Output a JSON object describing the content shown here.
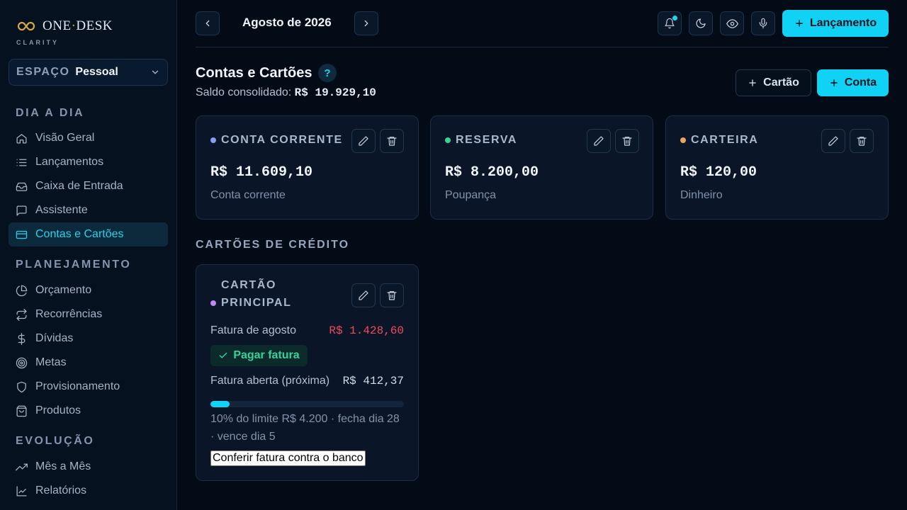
{
  "brand": {
    "name_left": "ONE",
    "name_sep": "·",
    "name_right": "DESK",
    "subtitle": "CLARITY"
  },
  "space": {
    "label": "ESPAÇO",
    "value": "Pessoal"
  },
  "sidebar": {
    "sections": [
      {
        "title": "DIA A DIA",
        "items": [
          {
            "label": "Visão Geral",
            "icon": "home-icon"
          },
          {
            "label": "Lançamentos",
            "icon": "list-icon"
          },
          {
            "label": "Caixa de Entrada",
            "icon": "inbox-icon"
          },
          {
            "label": "Assistente",
            "icon": "chat-icon"
          },
          {
            "label": "Contas e Cartões",
            "icon": "credit-card-icon",
            "active": true
          }
        ]
      },
      {
        "title": "PLANEJAMENTO",
        "items": [
          {
            "label": "Orçamento",
            "icon": "pie-chart-icon"
          },
          {
            "label": "Recorrências",
            "icon": "repeat-icon"
          },
          {
            "label": "Dívidas",
            "icon": "dollar-icon"
          },
          {
            "label": "Metas",
            "icon": "target-icon"
          },
          {
            "label": "Provisionamento",
            "icon": "shield-icon"
          },
          {
            "label": "Produtos",
            "icon": "shopping-bag-icon"
          }
        ]
      },
      {
        "title": "EVOLUÇÃO",
        "items": [
          {
            "label": "Mês a Mês",
            "icon": "trending-up-icon"
          },
          {
            "label": "Relatórios",
            "icon": "line-chart-icon"
          }
        ]
      }
    ]
  },
  "topbar": {
    "month": "Agosto de 2026",
    "new_entry_label": "Lançamento"
  },
  "main": {
    "title": "Contas e Cartões",
    "help": "?",
    "saldo_label": "Saldo consolidado:",
    "saldo_value": "R$ 19.929,10",
    "add_card_label": "Cartão",
    "add_account_label": "Conta"
  },
  "accounts": [
    {
      "name": "CONTA CORRENTE",
      "amount": "R$ 11.609,10",
      "type": "Conta corrente",
      "color": "#8b9cf7"
    },
    {
      "name": "RESERVA",
      "amount": "R$ 8.200,00",
      "type": "Poupança",
      "color": "#34d399"
    },
    {
      "name": "CARTEIRA",
      "amount": "R$ 120,00",
      "type": "Dinheiro",
      "color": "#f0a35e"
    }
  ],
  "credit_cards": {
    "heading": "CARTÕES DE CRÉDITO",
    "cards": [
      {
        "name_line1": "CARTÃO",
        "name_line2": "PRINCIPAL",
        "color": "#c084fc",
        "invoice_label": "Fatura de agosto",
        "invoice_value": "R$ 1.428,60",
        "pay_label": "Pagar fatura",
        "open_label": "Fatura aberta (próxima)",
        "open_value": "R$ 412,37",
        "limit_usage": 0.1,
        "limit_text": "10% do limite R$ 4.200 · fecha dia 28 · vence dia 5",
        "check_label": "Conferir fatura contra o banco"
      }
    ]
  },
  "colors": {
    "accent": "#0fd2f5",
    "danger": "#ef4a5a",
    "success": "#34d399"
  }
}
